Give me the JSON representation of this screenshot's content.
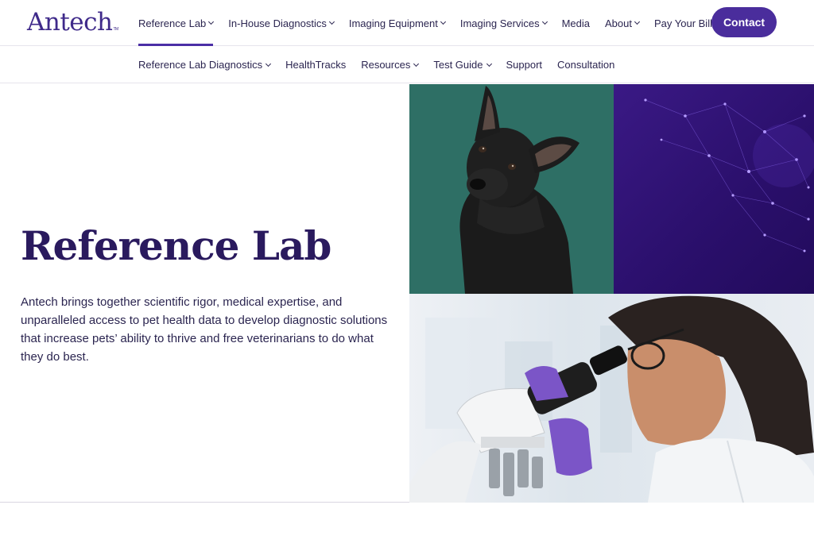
{
  "brand": {
    "name": "Antech",
    "tm": "TM"
  },
  "nav": {
    "items": [
      {
        "label": "Reference Lab",
        "has_menu": true,
        "active": true
      },
      {
        "label": "In-House Diagnostics",
        "has_menu": true
      },
      {
        "label": "Imaging Equipment",
        "has_menu": true
      },
      {
        "label": "Imaging Services",
        "has_menu": true
      },
      {
        "label": "Media",
        "has_menu": false
      },
      {
        "label": "About",
        "has_menu": true
      },
      {
        "label": "Pay Your Bill",
        "has_menu": true
      }
    ],
    "contact_label": "Contact"
  },
  "subnav": {
    "items": [
      {
        "label": "Reference Lab Diagnostics",
        "has_menu": true
      },
      {
        "label": "HealthTracks",
        "has_menu": false
      },
      {
        "label": "Resources",
        "has_menu": true
      },
      {
        "label": "Test Guide",
        "has_menu": true
      },
      {
        "label": "Support",
        "has_menu": false
      },
      {
        "label": "Consultation",
        "has_menu": false
      }
    ]
  },
  "hero": {
    "title": "Reference Lab",
    "description": "Antech brings together scientific rigor, medical expertise, and unparalleled access to pet health data to develop diagnostic solutions that increase pets’ ability to thrive and free veterinarians to do what they do best."
  },
  "colors": {
    "brand_purple": "#4a2d9c",
    "heading_navy": "#2a1a5e",
    "dog_bg_teal": "#2e6f65",
    "data_purple": "#2a0f6b"
  }
}
